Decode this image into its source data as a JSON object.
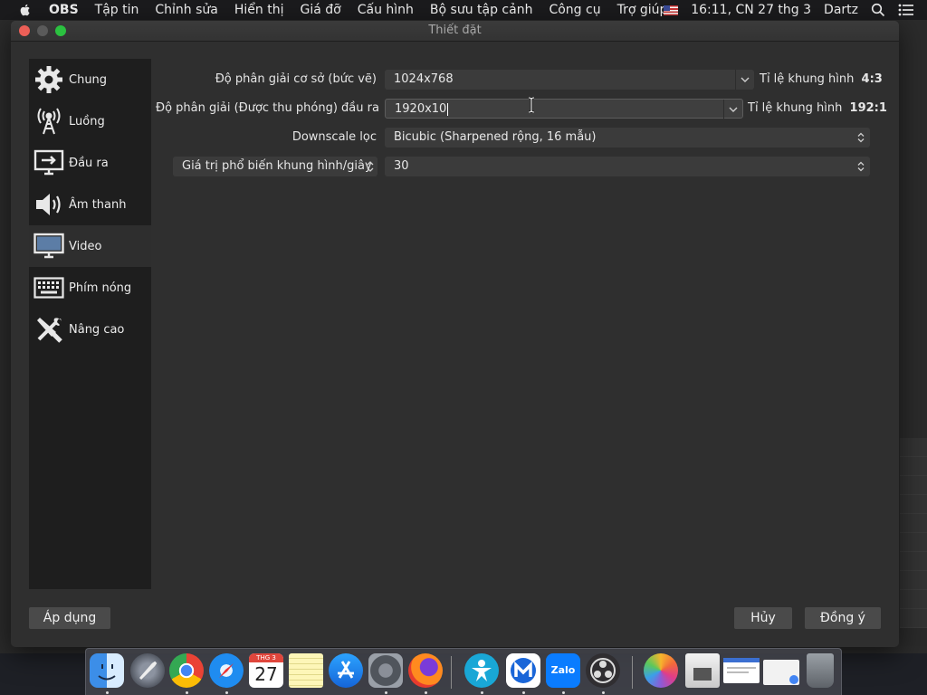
{
  "menubar": {
    "app_name": "OBS",
    "items": [
      "Tập tin",
      "Chỉnh sửa",
      "Hiển thị",
      "Giá đỡ",
      "Cấu hình",
      "Bộ sưu tập cảnh",
      "Công cụ",
      "Trợ giúp"
    ],
    "clock": "16:11, CN 27 thg 3",
    "user": "Dartz",
    "icons": [
      "apple-logo-icon",
      "us-flag-icon",
      "spotlight-search-icon",
      "control-center-icon"
    ]
  },
  "window": {
    "title": "Thiết đặt"
  },
  "sidebar": {
    "items": [
      {
        "label": "Chung",
        "icon": "gear-icon"
      },
      {
        "label": "Luồng",
        "icon": "broadcast-antenna-icon"
      },
      {
        "label": "Đầu ra",
        "icon": "output-monitor-icon"
      },
      {
        "label": "Âm thanh",
        "icon": "speaker-icon"
      },
      {
        "label": "Video",
        "icon": "monitor-icon",
        "active": true
      },
      {
        "label": "Phím nóng",
        "icon": "keyboard-icon"
      },
      {
        "label": "Nâng cao",
        "icon": "tools-icon"
      }
    ]
  },
  "video": {
    "base_resolution": {
      "label": "Độ phân giải cơ sở (bức vẽ)",
      "value": "1024x768",
      "ratio_label": "Tỉ lệ khung hình",
      "ratio_value": "4:3"
    },
    "output_resolution": {
      "label": "Độ phân giải (Được thu phóng) đầu ra",
      "value": "1920x10",
      "ratio_label": "Tỉ lệ khung hình",
      "ratio_value": "192:1"
    },
    "downscale_filter": {
      "label": "Downscale lọc",
      "value": "Bicubic (Sharpened rộng, 16 mẫu)"
    },
    "fps": {
      "type_value": "Giá trị phổ biến khung hình/giây",
      "value": "30"
    }
  },
  "buttons": {
    "apply": "Áp dụng",
    "cancel": "Hủy",
    "ok": "Đồng ý"
  },
  "dock": {
    "calendar_month": "THG 3",
    "calendar_day": "27",
    "apps": [
      "finder-icon",
      "launchpad-icon",
      "chrome-icon",
      "safari-icon",
      "calendar-icon",
      "notes-icon",
      "app-store-icon",
      "system-preferences-icon",
      "firefox-icon",
      "teamviewer-icon",
      "malwarebytes-icon",
      "zalo-icon",
      "obs-icon",
      "photos-icon",
      "preview-icon",
      "document-icon",
      "chrome-window-icon",
      "trash-icon"
    ],
    "zalo_label": "Zalo"
  },
  "colors": {
    "accent_red": "#ec5f57",
    "accent_green": "#2bc140",
    "sidebar_bg": "#1e1e1e",
    "window_bg": "#2f2f2f"
  }
}
